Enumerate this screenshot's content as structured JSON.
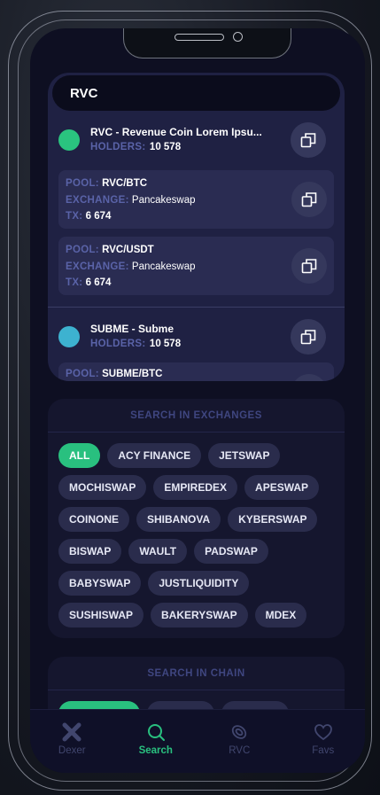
{
  "search": {
    "query": "RVC"
  },
  "coins": [
    {
      "name": "RVC - Revenue Coin Lorem Ipsu...",
      "holders_label": "HOLDERS:",
      "holders": "10 578",
      "dot_color": "#2ac47f",
      "pools": [
        {
          "pool_label": "POOL:",
          "pool": "RVC/BTC",
          "exchange_label": "EXCHANGE:",
          "exchange": "Pancakeswap",
          "tx_label": "TX:",
          "tx": "6 674"
        },
        {
          "pool_label": "POOL:",
          "pool": "RVC/USDT",
          "exchange_label": "EXCHANGE:",
          "exchange": "Pancakeswap",
          "tx_label": "TX:",
          "tx": "6 674"
        }
      ]
    },
    {
      "name": "SUBME - Subme",
      "holders_label": "HOLDERS:",
      "holders": "10 578",
      "dot_color": "#3db2d0",
      "pools": [
        {
          "pool_label": "POOL:",
          "pool": "SUBME/BTC"
        }
      ]
    }
  ],
  "exchanges": {
    "title": "SEARCH IN EXCHANGES",
    "chips": [
      "ALL",
      "ACY FINANCE",
      "JETSWAP",
      "MOCHISWAP",
      "EMPIREDEX",
      "APESWAP",
      "COINONE",
      "SHIBANOVA",
      "KYBERSWAP",
      "BISWAP",
      "WAULT",
      "PADSWAP",
      "BABYSWAP",
      "JUSTLIQUIDITY",
      "SUSHISWAP",
      "BAKERYSWAP",
      "MDEX"
    ],
    "active": "ALL"
  },
  "chain": {
    "title": "SEARCH IN CHAIN"
  },
  "tabs": [
    {
      "label": "Dexer",
      "icon": "dexer-x-icon"
    },
    {
      "label": "Search",
      "icon": "search-icon"
    },
    {
      "label": "RVC",
      "icon": "rvc-coin-icon"
    },
    {
      "label": "Favs",
      "icon": "heart-icon"
    }
  ],
  "colors": {
    "accent": "#29c07f",
    "background": "#0e0f22",
    "card": "#1f2143"
  }
}
